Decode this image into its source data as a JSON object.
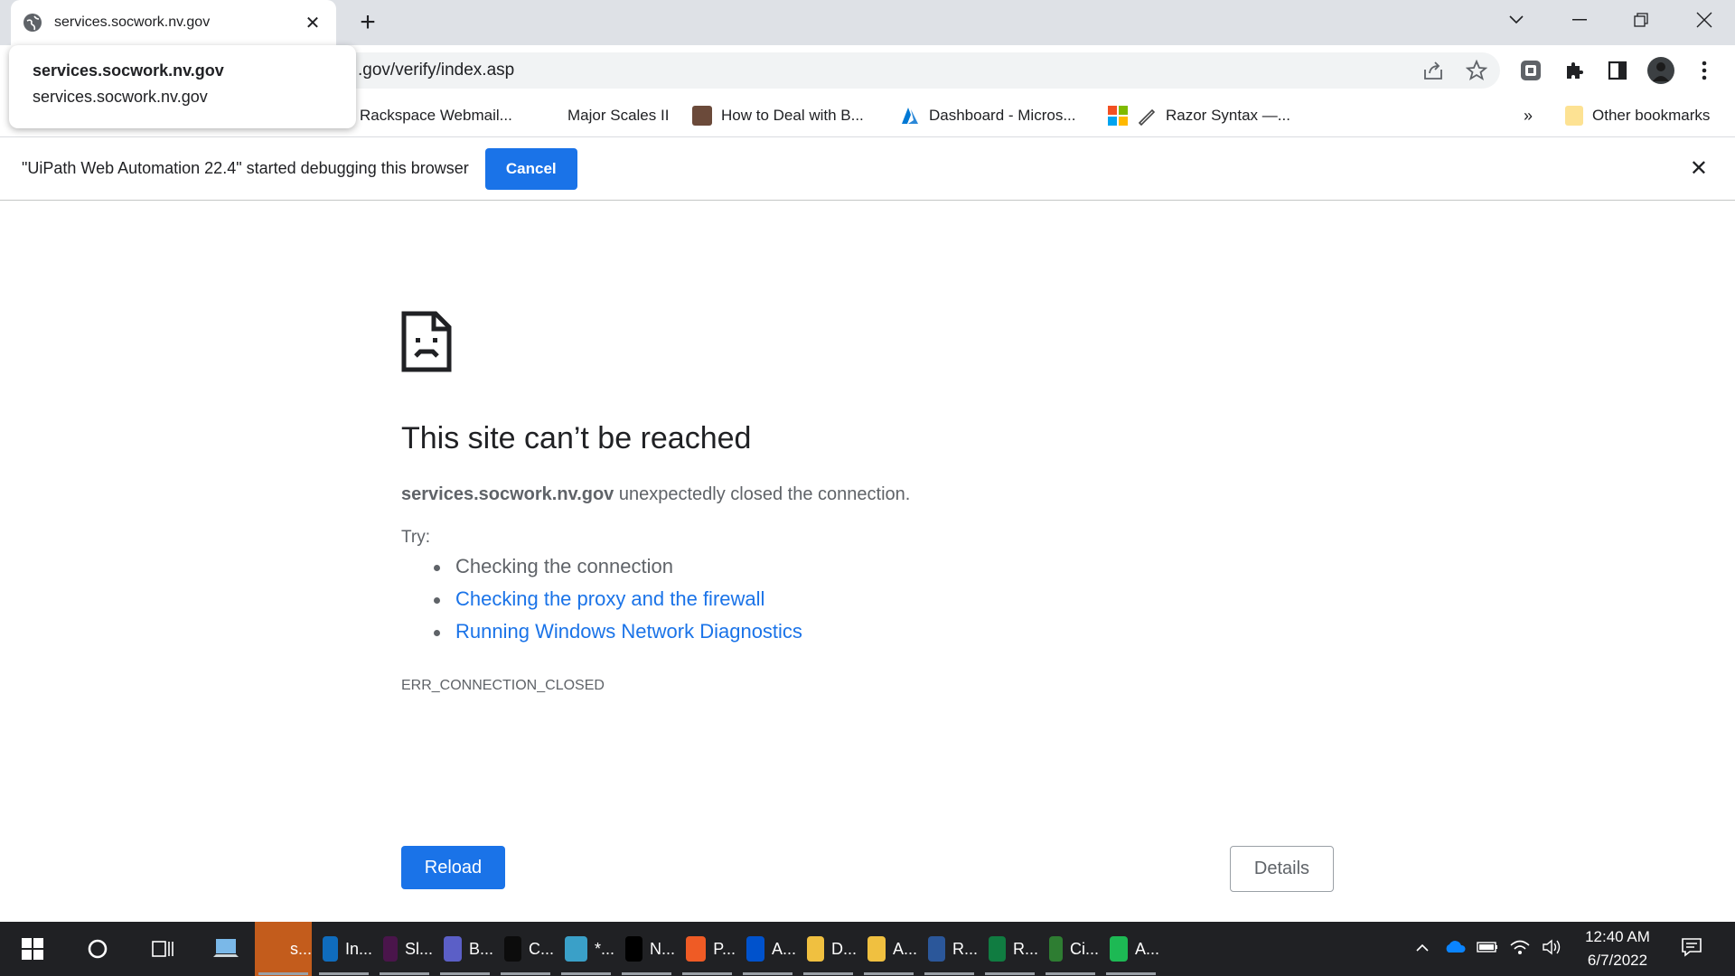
{
  "browser": {
    "tab_title": "services.socwork.nv.gov",
    "new_tab": "+",
    "omnibox_text": ".gov/verify/index.asp",
    "popup": {
      "line1": "services.socwork.nv.gov",
      "line2": "services.socwork.nv.gov"
    },
    "bookmarks": [
      {
        "label": "Rackspace Webmail...",
        "icon": "rackspace-icon",
        "color": "#ffffff"
      },
      {
        "label": "Major Scales II",
        "icon": "none",
        "color": "#ffffff"
      },
      {
        "label": "How to Deal with B...",
        "icon": "book-icon",
        "color": "#6b4a3a"
      },
      {
        "label": "Dashboard - Micros...",
        "icon": "azure-icon",
        "color": "#0078d4"
      },
      {
        "label": "Razor Syntax —...",
        "icon": "razor-icon",
        "color": "#444444"
      }
    ],
    "bookmarks_overflow": "»",
    "other_bookmarks": "Other bookmarks"
  },
  "infobar": {
    "message": "\"UiPath Web Automation 22.4\" started debugging this browser",
    "cancel_label": "Cancel",
    "close": "✕"
  },
  "error_page": {
    "title": "This site can’t be reached",
    "host": "services.socwork.nv.gov",
    "description_rest": " unexpectedly closed the connection.",
    "try_label": "Try:",
    "suggestions": [
      {
        "text": "Checking the connection",
        "link": false
      },
      {
        "text": "Checking the proxy and the firewall",
        "link": true
      },
      {
        "text": "Running Windows Network Diagnostics",
        "link": true
      }
    ],
    "error_code": "ERR_CONNECTION_CLOSED",
    "reload_label": "Reload",
    "details_label": "Details"
  },
  "taskbar": {
    "items": [
      {
        "label": "s...",
        "icon": "chrome-icon",
        "color": "#c35c1c",
        "active": true
      },
      {
        "label": "In...",
        "icon": "outlook-icon",
        "color": "#0f6cbd"
      },
      {
        "label": "Sl...",
        "icon": "slack-icon",
        "color": "#4a154b"
      },
      {
        "label": "B...",
        "icon": "teams-icon",
        "color": "#5b5fc7"
      },
      {
        "label": "C...",
        "icon": "terminal-icon",
        "color": "#0c0c0c"
      },
      {
        "label": "*...",
        "icon": "notepad-icon",
        "color": "#3aa0c8"
      },
      {
        "label": "N...",
        "icon": "pycharm-icon",
        "color": "#000000"
      },
      {
        "label": "P...",
        "icon": "postman-icon",
        "color": "#ef5b25"
      },
      {
        "label": "A...",
        "icon": "sourcetree-icon",
        "color": "#0052cc"
      },
      {
        "label": "D...",
        "icon": "folder-icon",
        "color": "#f0c040"
      },
      {
        "label": "A...",
        "icon": "folder-icon",
        "color": "#f0c040"
      },
      {
        "label": "R...",
        "icon": "rdp-icon",
        "color": "#2b579a"
      },
      {
        "label": "R...",
        "icon": "excel-icon",
        "color": "#107c41"
      },
      {
        "label": "Ci...",
        "icon": "globe-icon",
        "color": "#2e7d32"
      },
      {
        "label": "A...",
        "icon": "uipath-icon",
        "color": "#1db954"
      }
    ],
    "time": "12:40 AM",
    "date": "6/7/2022"
  }
}
